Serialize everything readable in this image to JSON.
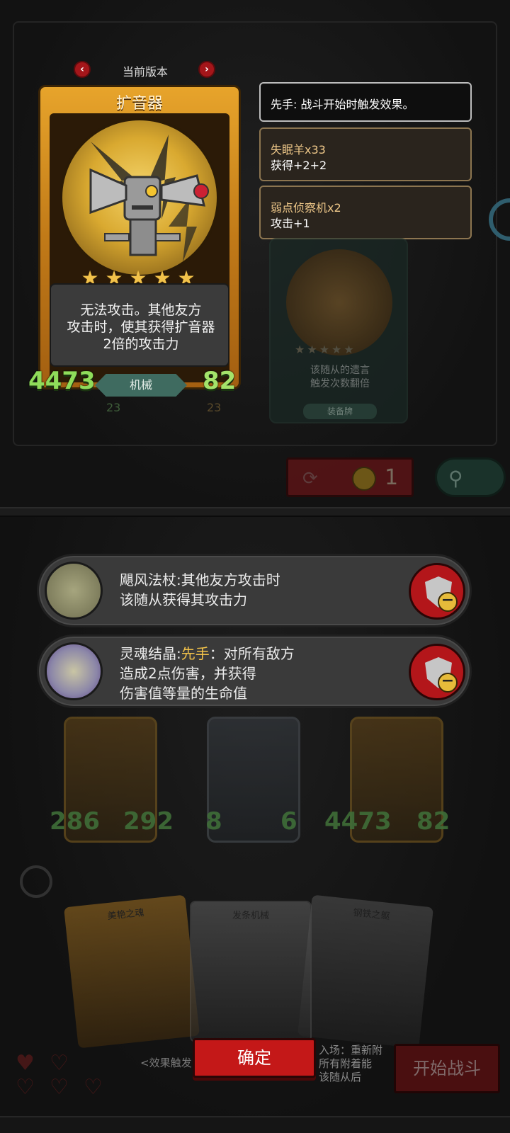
{
  "header": {
    "version_label": "当前版本"
  },
  "featured_card": {
    "name": "扩音器",
    "star_count": 5,
    "description_lines": [
      "无法攻击。其他友方",
      "攻击时，使其获得扩音器",
      "2倍的攻击力"
    ],
    "attack": "4473",
    "health": "82",
    "type": "机械",
    "sub_attack": "23",
    "sub_health": "23"
  },
  "info_panel": {
    "first": "先手: 战斗开始时触发效果。",
    "items": [
      {
        "title": "失眠羊x33",
        "detail": "获得+2+2"
      },
      {
        "title": "弱点侦察机x2",
        "detail": "攻击+1"
      }
    ]
  },
  "back_card": {
    "description_lines": [
      "该随从的遗言",
      "触发次数翻倍"
    ],
    "tag": "装备牌"
  },
  "refresh": {
    "cost": "1"
  },
  "effects": [
    {
      "name": "飓风法杖",
      "text_lines": [
        "飓风法杖:其他友方攻击时",
        "该随从获得其攻击力"
      ]
    },
    {
      "name": "灵魂结晶",
      "prefix": "灵魂结晶:",
      "keyword": "先手",
      "text_lines": [
        "：对所有敌方",
        "造成2点伤害，并获得",
        "伤害值等量的生命值"
      ]
    }
  ],
  "board_minions": [
    {
      "attack": "286",
      "health": "292"
    },
    {
      "attack": "8",
      "health": "6"
    },
    {
      "attack": "4473",
      "health": "82"
    }
  ],
  "hand_cards": [
    {
      "title": "美艳之魂"
    },
    {
      "title": "发条机械"
    },
    {
      "title": "钢铁之躯"
    }
  ],
  "hand_fragments": {
    "left": "<效果触发",
    "right_lines": [
      "入场：重新附",
      "所有附着能",
      "该随从后"
    ]
  },
  "buttons": {
    "confirm": "确定",
    "start_battle": "开始战斗"
  },
  "colors": {
    "accent_red": "#c41818",
    "card_gold": "#e7a42b",
    "stat_green": "#8fdc5a"
  }
}
